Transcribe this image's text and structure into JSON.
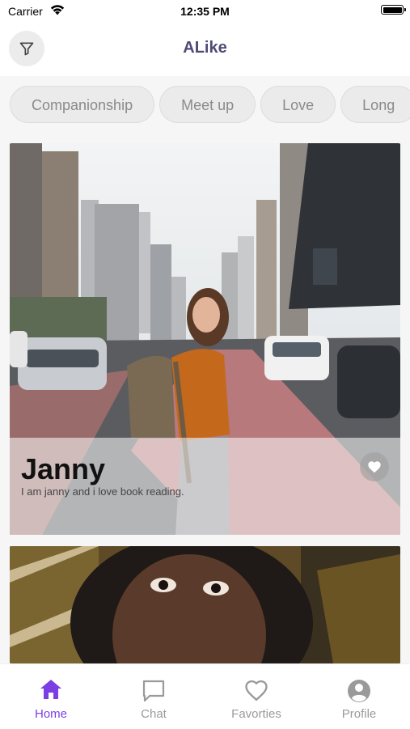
{
  "status_bar": {
    "carrier": "Carrier",
    "time": "12:35 PM"
  },
  "header": {
    "title": "ALike",
    "filter_icon": "filter-icon"
  },
  "categories": [
    "Companionship",
    "Meet up",
    "Love",
    "Long"
  ],
  "profiles": [
    {
      "name": "Janny",
      "description": "I am janny and i love book reading.",
      "favorite_icon": "heart-icon"
    }
  ],
  "tabs": [
    {
      "label": "Home",
      "icon": "home-icon",
      "active": true
    },
    {
      "label": "Chat",
      "icon": "chat-icon",
      "active": false
    },
    {
      "label": "Favorties",
      "icon": "heart-outline-icon",
      "active": false
    },
    {
      "label": "Profile",
      "icon": "profile-icon",
      "active": false
    }
  ],
  "colors": {
    "accent": "#7b3fe4",
    "title": "#4e4a78",
    "inactive_tab": "#9a9a9a"
  }
}
